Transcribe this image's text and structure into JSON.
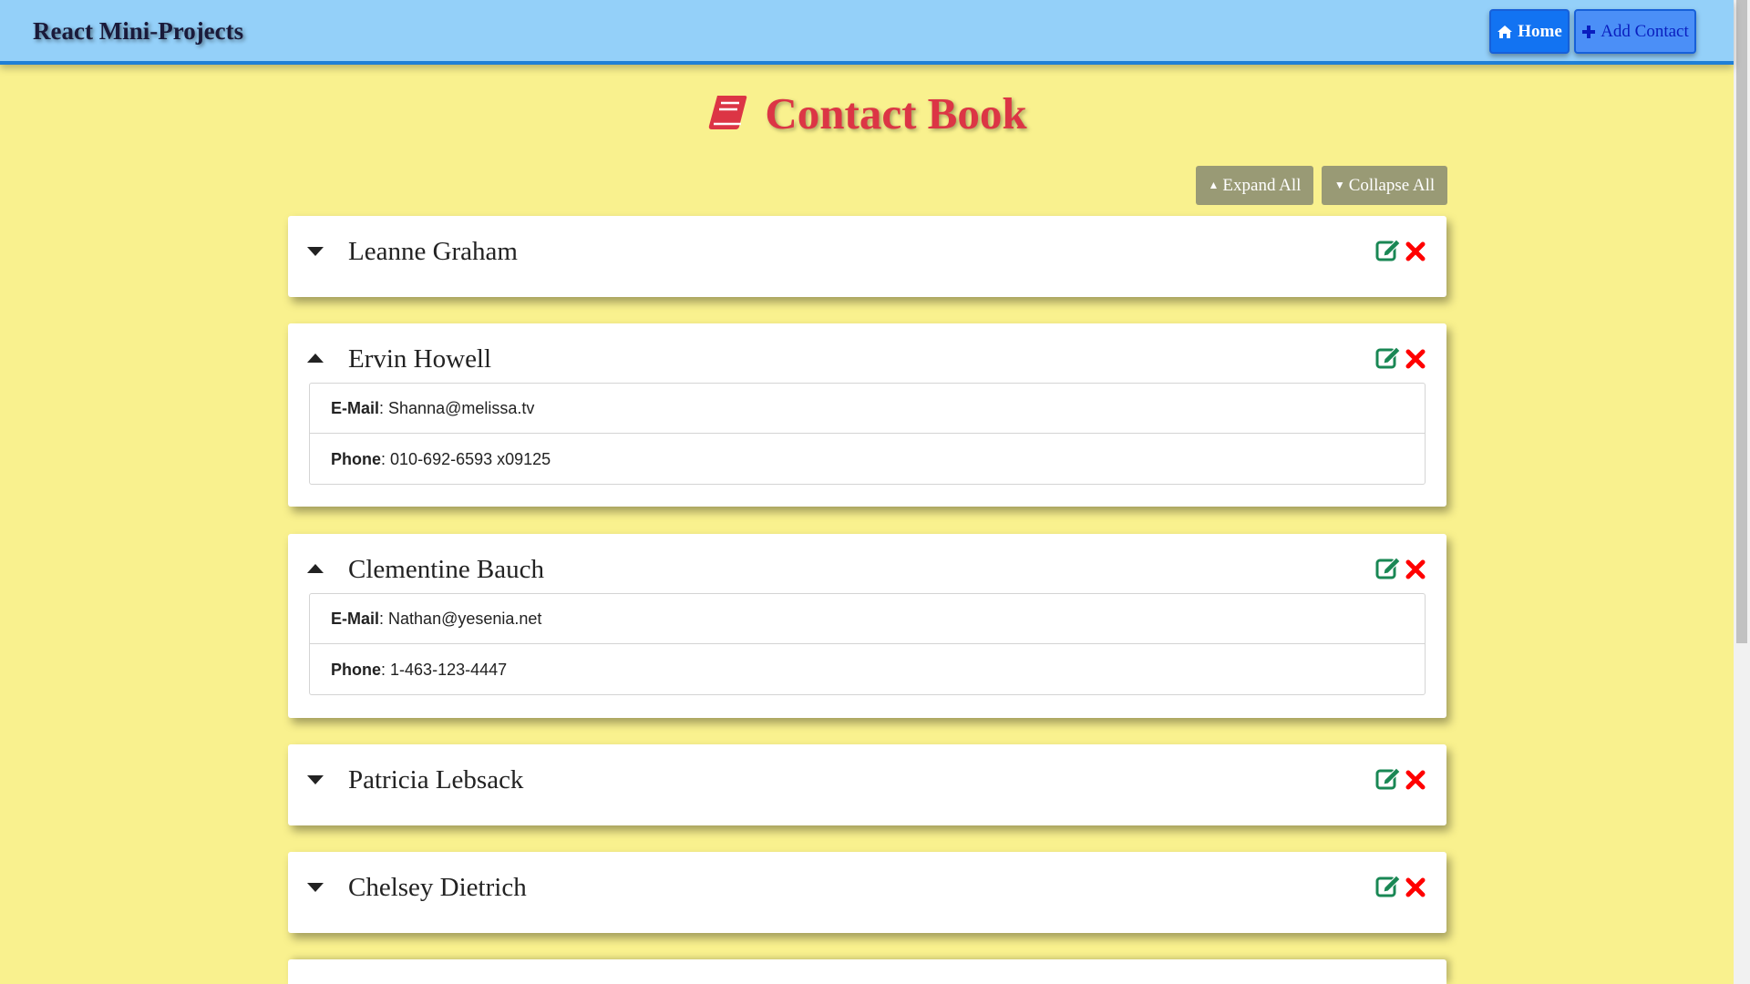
{
  "navbar": {
    "brand": "React Mini-Projects",
    "home_label": "Home",
    "add_contact_label": "Add Contact"
  },
  "page": {
    "title": "Contact Book"
  },
  "toolbar": {
    "expand_all_label": "Expand All",
    "collapse_all_label": "Collapse All"
  },
  "labels": {
    "email": "E-Mail",
    "phone": "Phone",
    "separator": ": "
  },
  "contacts": [
    {
      "name": "Leanne Graham",
      "expanded": false
    },
    {
      "name": "Ervin Howell",
      "expanded": true,
      "email": "Shanna@melissa.tv",
      "phone": "010-692-6593 x09125"
    },
    {
      "name": "Clementine Bauch",
      "expanded": true,
      "email": "Nathan@yesenia.net",
      "phone": "1-463-123-4447"
    },
    {
      "name": "Patricia Lebsack",
      "expanded": false
    },
    {
      "name": "Chelsey Dietrich",
      "expanded": false
    }
  ],
  "colors": {
    "page_background": "#f9f18e",
    "navbar_background": "#94d0f9",
    "title": "#dc3545",
    "edit_icon": "#198754",
    "delete_icon": "#ff0000",
    "toolbar_button": "#999a75",
    "home_button": "#1273f2"
  },
  "icons": {
    "home": "home-icon",
    "add": "plus-icon",
    "title": "book-icon",
    "edit": "edit-icon",
    "delete": "close-icon",
    "expanded": "caret-up-icon",
    "collapsed": "caret-down-icon"
  }
}
